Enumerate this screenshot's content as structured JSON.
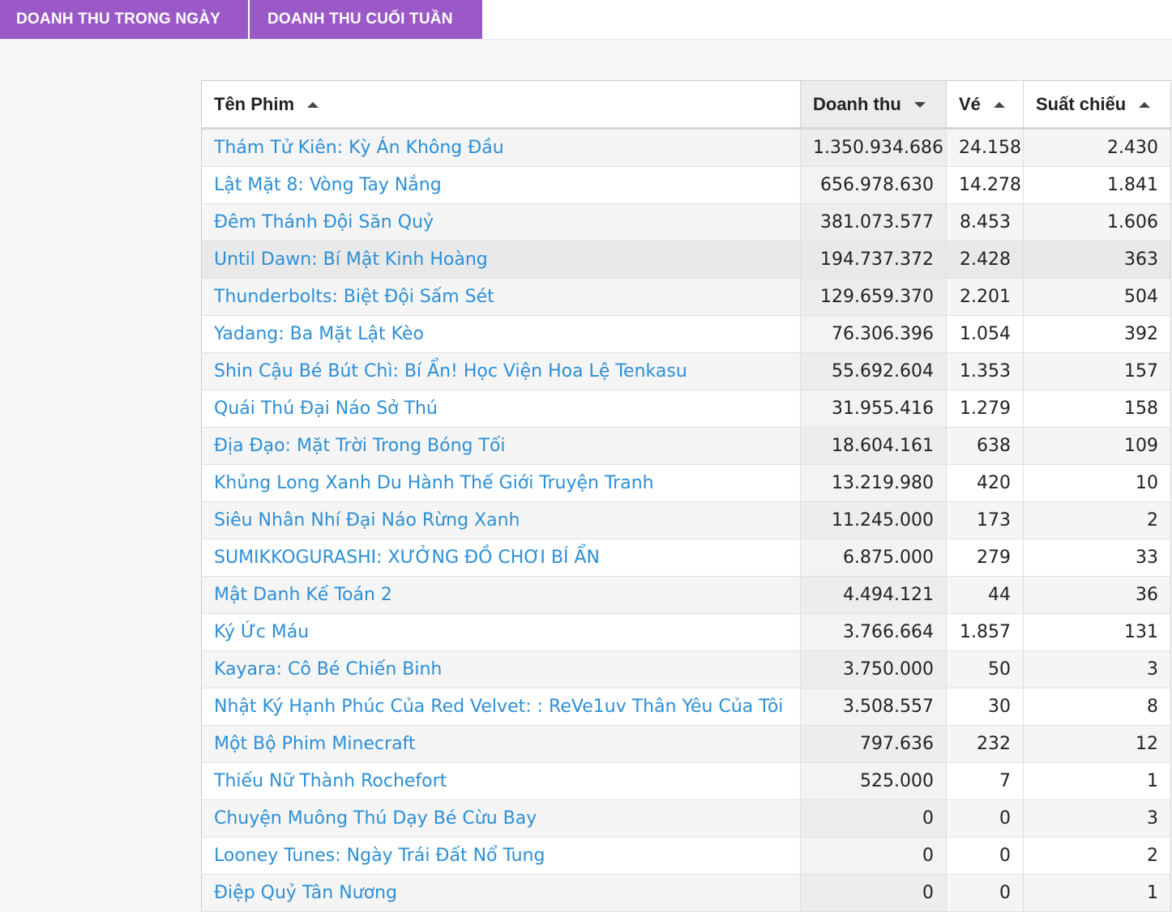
{
  "tabs": [
    {
      "label": "DOANH THU TRONG NGÀY"
    },
    {
      "label": "DOANH THU CUỐI TUẦN"
    }
  ],
  "table": {
    "columns": [
      {
        "label": "Tên Phim",
        "sort": "asc"
      },
      {
        "label": "Doanh thu",
        "sort": "desc"
      },
      {
        "label": "Vé",
        "sort": "asc"
      },
      {
        "label": "Suất chiếu",
        "sort": "asc"
      }
    ],
    "rows": [
      {
        "title": "Thám Tử Kiên: Kỳ Án Không Đầu",
        "revenue": "1.350.934.686",
        "tickets": "24.158",
        "shows": "2.430"
      },
      {
        "title": "Lật Mặt 8: Vòng Tay Nắng",
        "revenue": "656.978.630",
        "tickets": "14.278",
        "shows": "1.841"
      },
      {
        "title": "Đêm Thánh Đội Săn Quỷ",
        "revenue": "381.073.577",
        "tickets": "8.453",
        "shows": "1.606"
      },
      {
        "title": "Until Dawn: Bí Mật Kinh Hoàng",
        "revenue": "194.737.372",
        "tickets": "2.428",
        "shows": "363"
      },
      {
        "title": "Thunderbolts: Biệt Đội Sấm Sét",
        "revenue": "129.659.370",
        "tickets": "2.201",
        "shows": "504"
      },
      {
        "title": "Yadang: Ba Mặt Lật Kèo",
        "revenue": "76.306.396",
        "tickets": "1.054",
        "shows": "392"
      },
      {
        "title": "Shin Cậu Bé Bút Chì: Bí Ẩn! Học Viện Hoa Lệ Tenkasu",
        "revenue": "55.692.604",
        "tickets": "1.353",
        "shows": "157"
      },
      {
        "title": "Quái Thú Đại Náo Sở Thú",
        "revenue": "31.955.416",
        "tickets": "1.279",
        "shows": "158"
      },
      {
        "title": "Địa Đạo: Mặt Trời Trong Bóng Tối",
        "revenue": "18.604.161",
        "tickets": "638",
        "shows": "109"
      },
      {
        "title": "Khủng Long Xanh Du Hành Thế Giới Truyện Tranh",
        "revenue": "13.219.980",
        "tickets": "420",
        "shows": "10"
      },
      {
        "title": "Siêu Nhân Nhí Đại Náo Rừng Xanh",
        "revenue": "11.245.000",
        "tickets": "173",
        "shows": "2"
      },
      {
        "title": "SUMIKKOGURASHI: XƯỞNG ĐỒ CHƠI BÍ ẨN",
        "revenue": "6.875.000",
        "tickets": "279",
        "shows": "33"
      },
      {
        "title": "Mật Danh Kế Toán 2",
        "revenue": "4.494.121",
        "tickets": "44",
        "shows": "36"
      },
      {
        "title": "Ký Ức Máu",
        "revenue": "3.766.664",
        "tickets": "1.857",
        "shows": "131"
      },
      {
        "title": "Kayara: Cô Bé Chiến Binh",
        "revenue": "3.750.000",
        "tickets": "50",
        "shows": "3"
      },
      {
        "title": "Nhật Ký Hạnh Phúc Của Red Velvet: : ReVe1uv Thân Yêu Của Tôi",
        "revenue": "3.508.557",
        "tickets": "30",
        "shows": "8"
      },
      {
        "title": "Một Bộ Phim Minecraft",
        "revenue": "797.636",
        "tickets": "232",
        "shows": "12"
      },
      {
        "title": "Thiếu Nữ Thành Rochefort",
        "revenue": "525.000",
        "tickets": "7",
        "shows": "1"
      },
      {
        "title": "Chuyện Muông Thú Dạy Bé Cừu Bay",
        "revenue": "0",
        "tickets": "0",
        "shows": "3"
      },
      {
        "title": "Looney Tunes: Ngày Trái Đất Nổ Tung",
        "revenue": "0",
        "tickets": "0",
        "shows": "2"
      },
      {
        "title": "Điệp Quỷ Tân Nương",
        "revenue": "0",
        "tickets": "0",
        "shows": "1"
      }
    ]
  },
  "colors": {
    "tab_bg": "#9b59c8",
    "link": "#2c8fd6"
  }
}
